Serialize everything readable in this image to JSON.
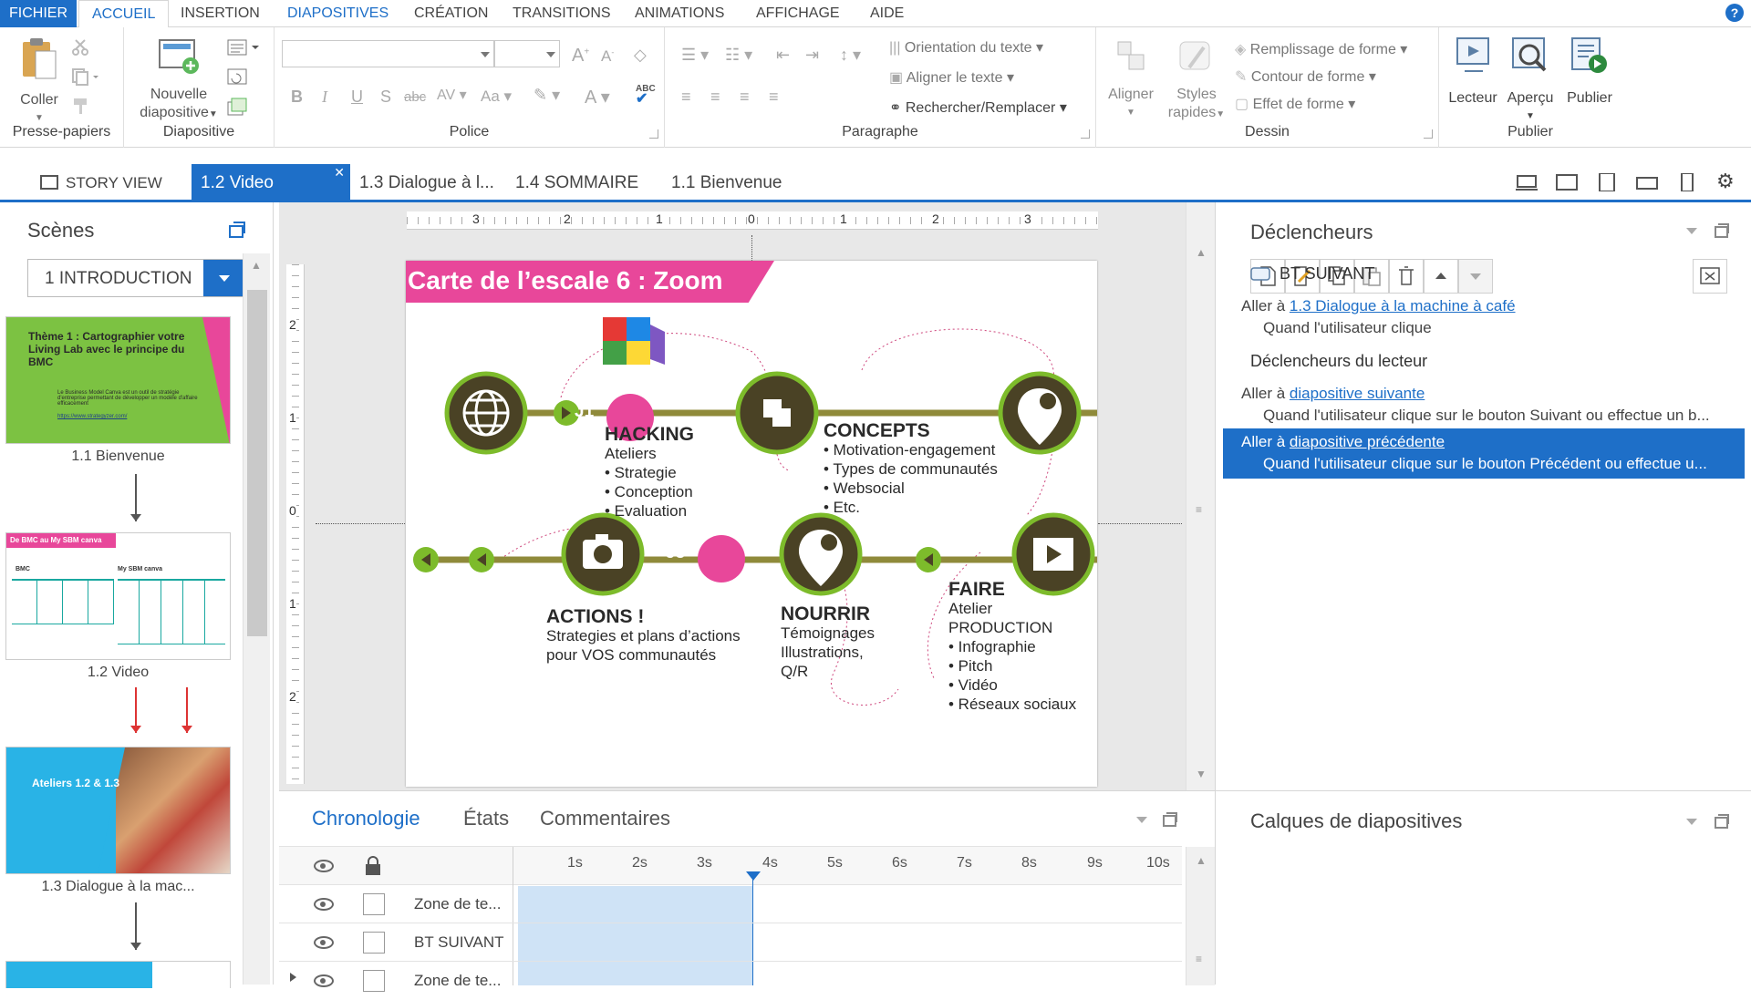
{
  "menu": {
    "file": "FICHIER",
    "items": [
      "ACCUEIL",
      "INSERTION",
      "DIAPOSITIVES",
      "CRÉATION",
      "TRANSITIONS",
      "ANIMATIONS",
      "AFFICHAGE",
      "AIDE"
    ],
    "help": "?"
  },
  "ribbon": {
    "clipboard": {
      "paste": "Coller",
      "label": "Presse-papiers"
    },
    "slide": {
      "new_slide_1": "Nouvelle",
      "new_slide_2": "diapositive",
      "label": "Diapositive"
    },
    "font": {
      "label": "Police",
      "bold": "B",
      "italic": "I",
      "underline": "U",
      "shadow": "S",
      "strike": "abc",
      "spacing": "AV",
      "case": "Aa",
      "color": "A",
      "spell": "ABC"
    },
    "paragraph": {
      "text_direction": "Orientation du texte",
      "align_text": "Aligner le texte",
      "find_replace": "Rechercher/Remplacer",
      "label": "Paragraphe"
    },
    "drawing": {
      "align": "Aligner",
      "quick_styles_1": "Styles",
      "quick_styles_2": "rapides",
      "fill": "Remplissage de forme",
      "outline": "Contour de forme",
      "effect": "Effet de forme",
      "label": "Dessin"
    },
    "publish": {
      "player": "Lecteur",
      "preview": "Aperçu",
      "publish": "Publier",
      "label": "Publier"
    }
  },
  "tabs": {
    "story_view": "STORY VIEW",
    "open": [
      "1.2 Video",
      "1.3 Dialogue à l...",
      "1.4 SOMMAIRE",
      "1.1 Bienvenue"
    ]
  },
  "scenes": {
    "title": "Scènes",
    "dropdown": "1 INTRODUCTION",
    "thumbs": [
      {
        "label": "1.1 Bienvenue",
        "title": "Thème 1 : Cartographier votre Living Lab avec le principe du BMC",
        "body": "Le Business Model Canva est un outil de stratégie d'entreprise permettant de développer un modèle d'affaire efficacement",
        "link": "https://www.strategyzer.com/"
      },
      {
        "label": "1.2 Video",
        "banner": "De BMC au My SBM canva",
        "left": "BMC",
        "right": "My SBM canva"
      },
      {
        "label": "1.3 Dialogue à la mac...",
        "title": "Ateliers 1.2 & 1.3"
      }
    ]
  },
  "slide": {
    "title": "Carte de l’escale 6 : Zoom",
    "j1": "J1",
    "j3": "J3",
    "hacking": {
      "title": "HACKING",
      "lines": [
        "Ateliers",
        "• Strategie",
        "• Conception",
        "• Evaluation"
      ]
    },
    "concepts": {
      "title": "CONCEPTS",
      "lines": [
        "• Motivation-engagement",
        "• Types de communautés",
        "• Websocial",
        "• Etc."
      ]
    },
    "actions": {
      "title": "ACTIONS !",
      "lines": [
        "Strategies et plans d’actions",
        "pour VOS communautés"
      ]
    },
    "nourrir": {
      "title": "NOURRIR",
      "lines": [
        "Témoignages",
        "Illustrations,",
        "Q/R"
      ]
    },
    "faire": {
      "title": "FAIRE",
      "lines": [
        "Atelier PRODUCTION",
        "• Infographie",
        "• Pitch",
        "• Vidéo",
        "• Réseaux sociaux"
      ]
    }
  },
  "ruler": {
    "h": [
      "3",
      "2",
      "1",
      "0",
      "1",
      "2",
      "3"
    ],
    "v": [
      "2",
      "1",
      "0",
      "1",
      "2"
    ]
  },
  "triggers": {
    "title": "Déclencheurs",
    "object": "BT SUIVANT",
    "t1_action": "Aller à",
    "t1_link": "1.3 Dialogue à la machine à café",
    "t1_when": "Quand l'utilisateur clique",
    "player_title": "Déclencheurs du lecteur",
    "t2_action": "Aller à",
    "t2_link": "diapositive suivante",
    "t2_when": "Quand l'utilisateur clique sur le bouton Suivant ou effectue un b...",
    "t3_action": "Aller à",
    "t3_link": "diapositive précédente",
    "t3_when": "Quand l'utilisateur clique sur le bouton Précédent ou effectue u..."
  },
  "layers": {
    "title": "Calques de diapositives"
  },
  "timeline": {
    "tabs": [
      "Chronologie",
      "États",
      "Commentaires"
    ],
    "ticks": [
      "1s",
      "2s",
      "3s",
      "4s",
      "5s",
      "6s",
      "7s",
      "8s",
      "9s",
      "10s"
    ],
    "rows": [
      "Zone de te...",
      "BT SUIVANT",
      "Zone de te..."
    ]
  },
  "colors": {
    "accent": "#1e6fc8",
    "pink": "#e8479a",
    "olive": "#4a4225",
    "green": "#7dbb2b",
    "selected": "#1e6fc8"
  }
}
